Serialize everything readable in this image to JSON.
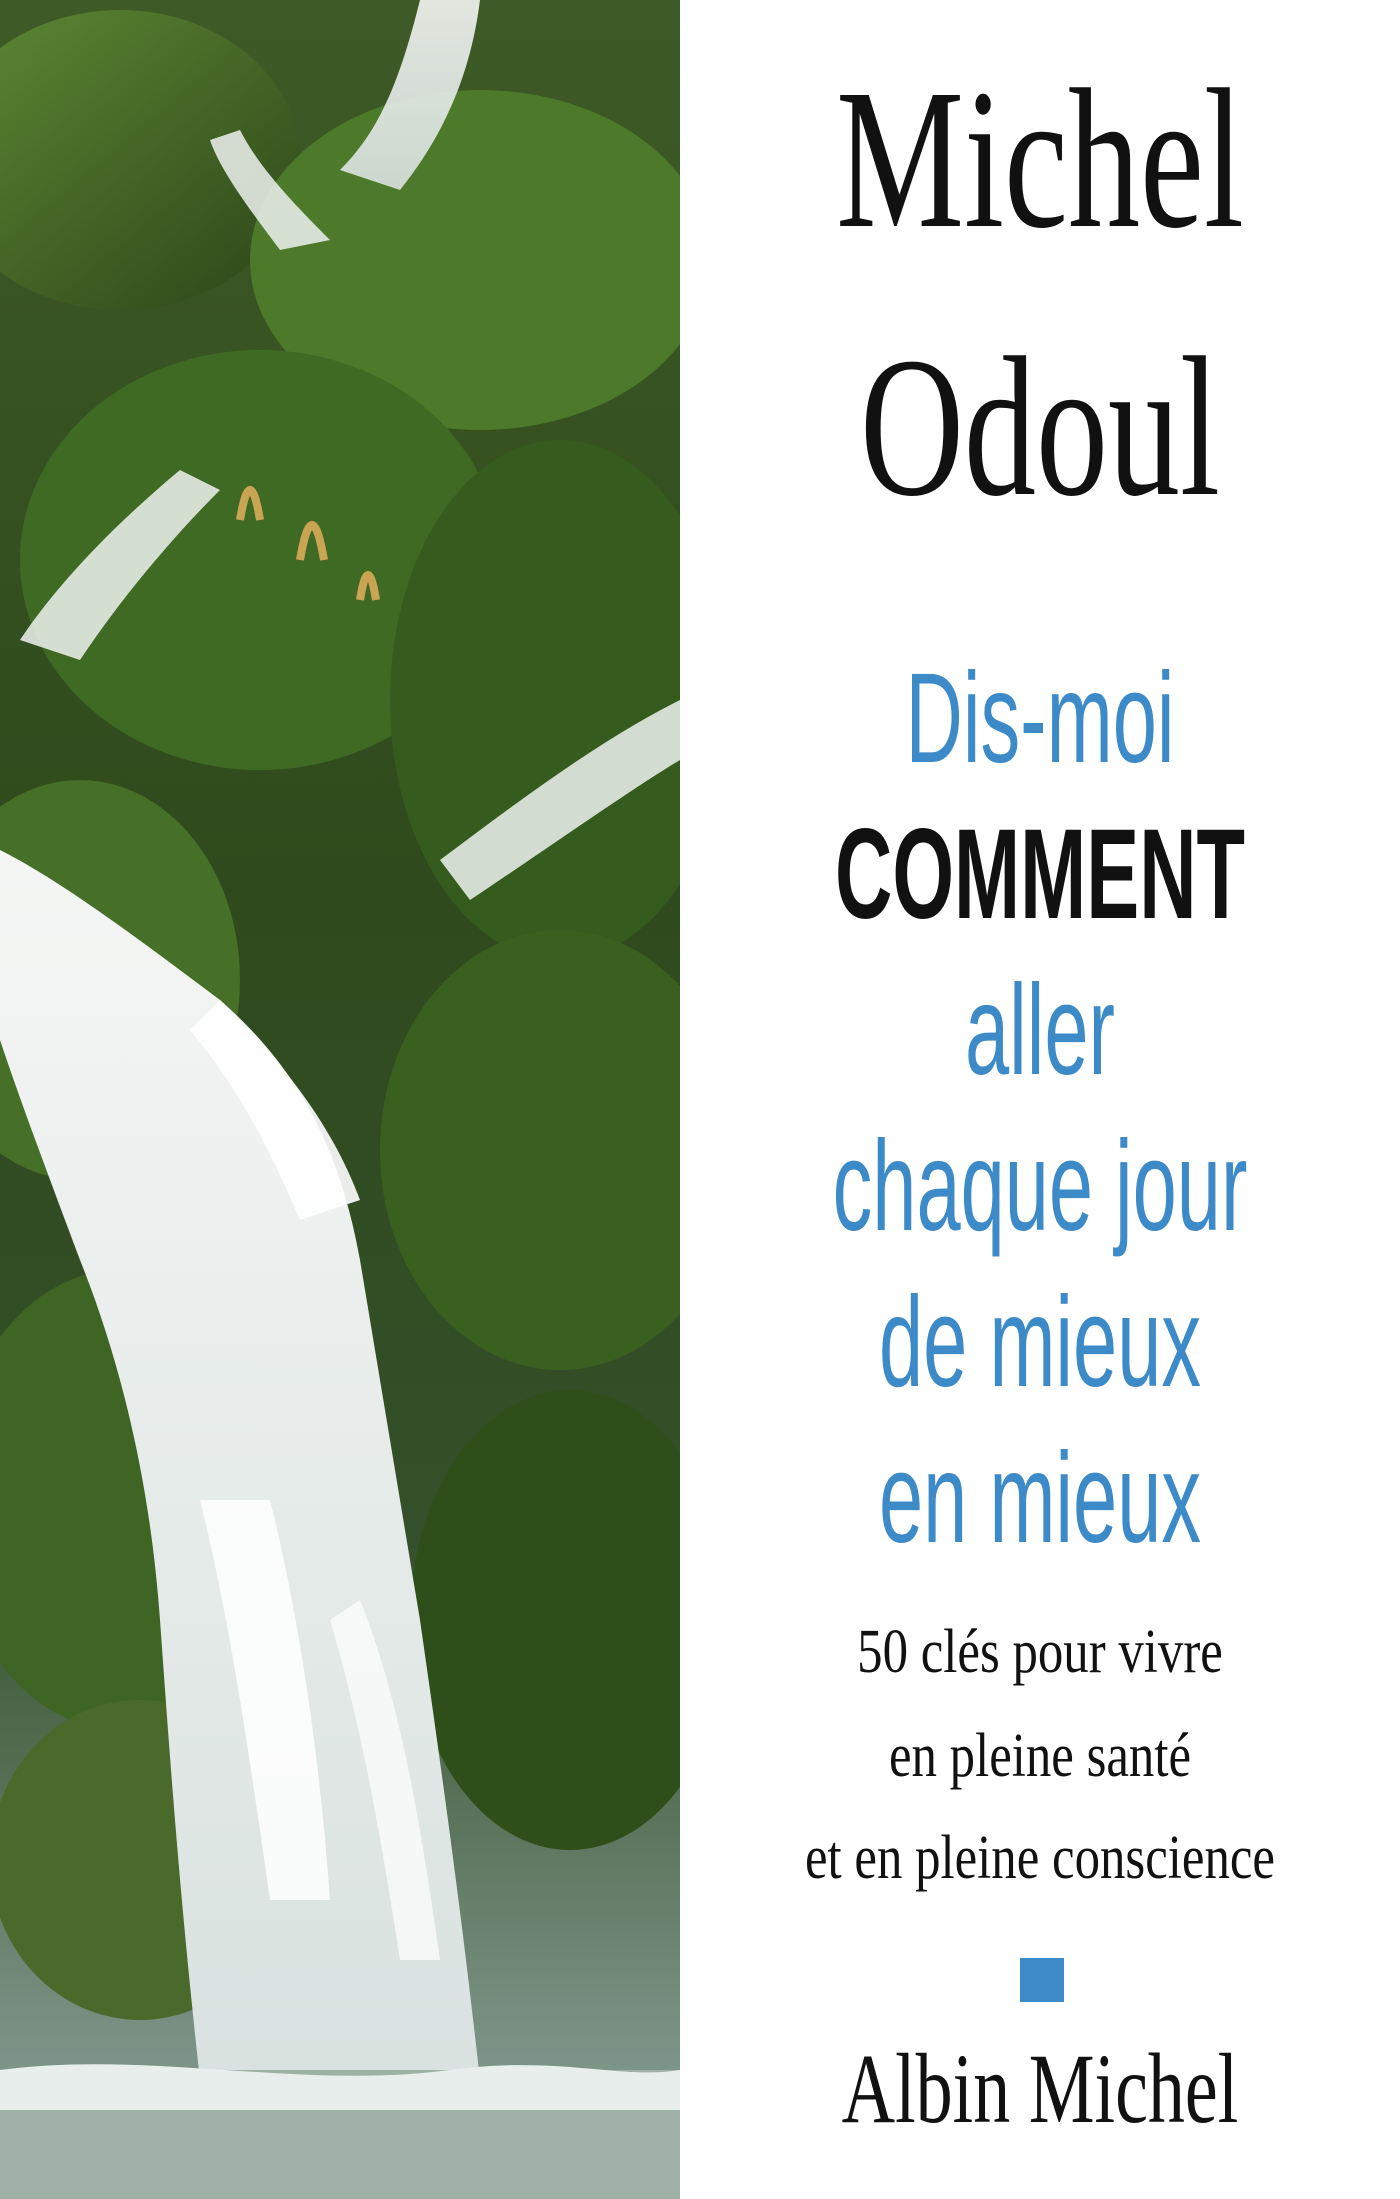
{
  "cover": {
    "author_line1": "Michel",
    "author_line2": "Odoul",
    "title_lines": [
      "Dis-moi",
      "COMMENT",
      "aller",
      "chaque jour",
      "de mieux",
      "en mieux"
    ],
    "subtitle_lines": [
      "50 clés pour vivre",
      "en pleine santé",
      "et en pleine conscience"
    ],
    "publisher": "Albin Michel",
    "colors": {
      "accent_blue": "#3c8ac7",
      "text_black": "#111111",
      "background": "#ffffff"
    },
    "image": "waterfall-photo"
  }
}
